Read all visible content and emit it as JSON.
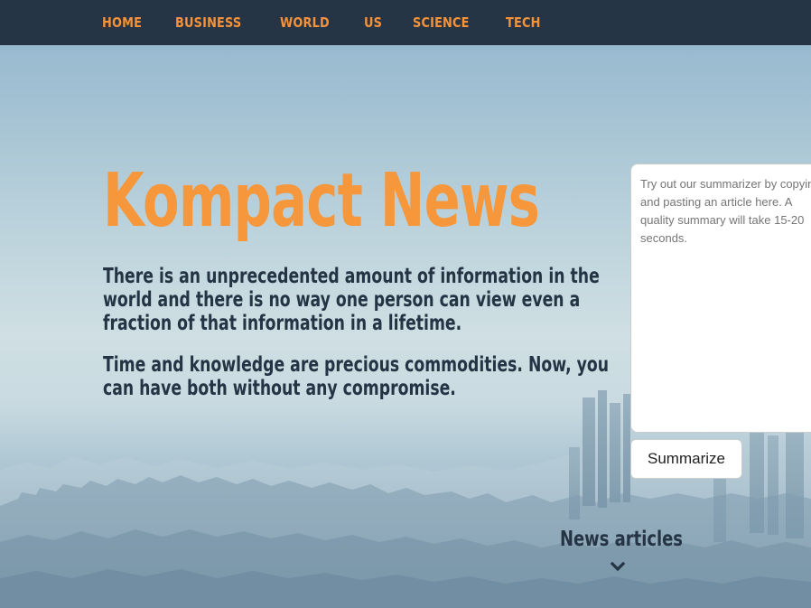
{
  "nav": {
    "items": [
      {
        "label": "HOME"
      },
      {
        "label": "BUSINESS"
      },
      {
        "label": "WORLD"
      },
      {
        "label": "US"
      },
      {
        "label": "SCIENCE"
      },
      {
        "label": "TECH"
      }
    ]
  },
  "hero": {
    "title": "Kompact News",
    "paragraphs": [
      "There is an unprecedented amount of information in the world and there is no way one person can view even a fraction of that information in a lifetime.",
      "Time and knowledge are precious commodities. Now, you can have both without any compromise."
    ]
  },
  "summarizer": {
    "placeholder": "Try out our summarizer by copying and pasting an article here. A quality summary will take 15-20 seconds.",
    "button_label": "Summarize"
  },
  "news_section": {
    "label": "News articles",
    "icon": "chevron-down-icon"
  },
  "colors": {
    "navbar": "#253545",
    "accent": "#f5973a",
    "text_dark": "#243444"
  }
}
